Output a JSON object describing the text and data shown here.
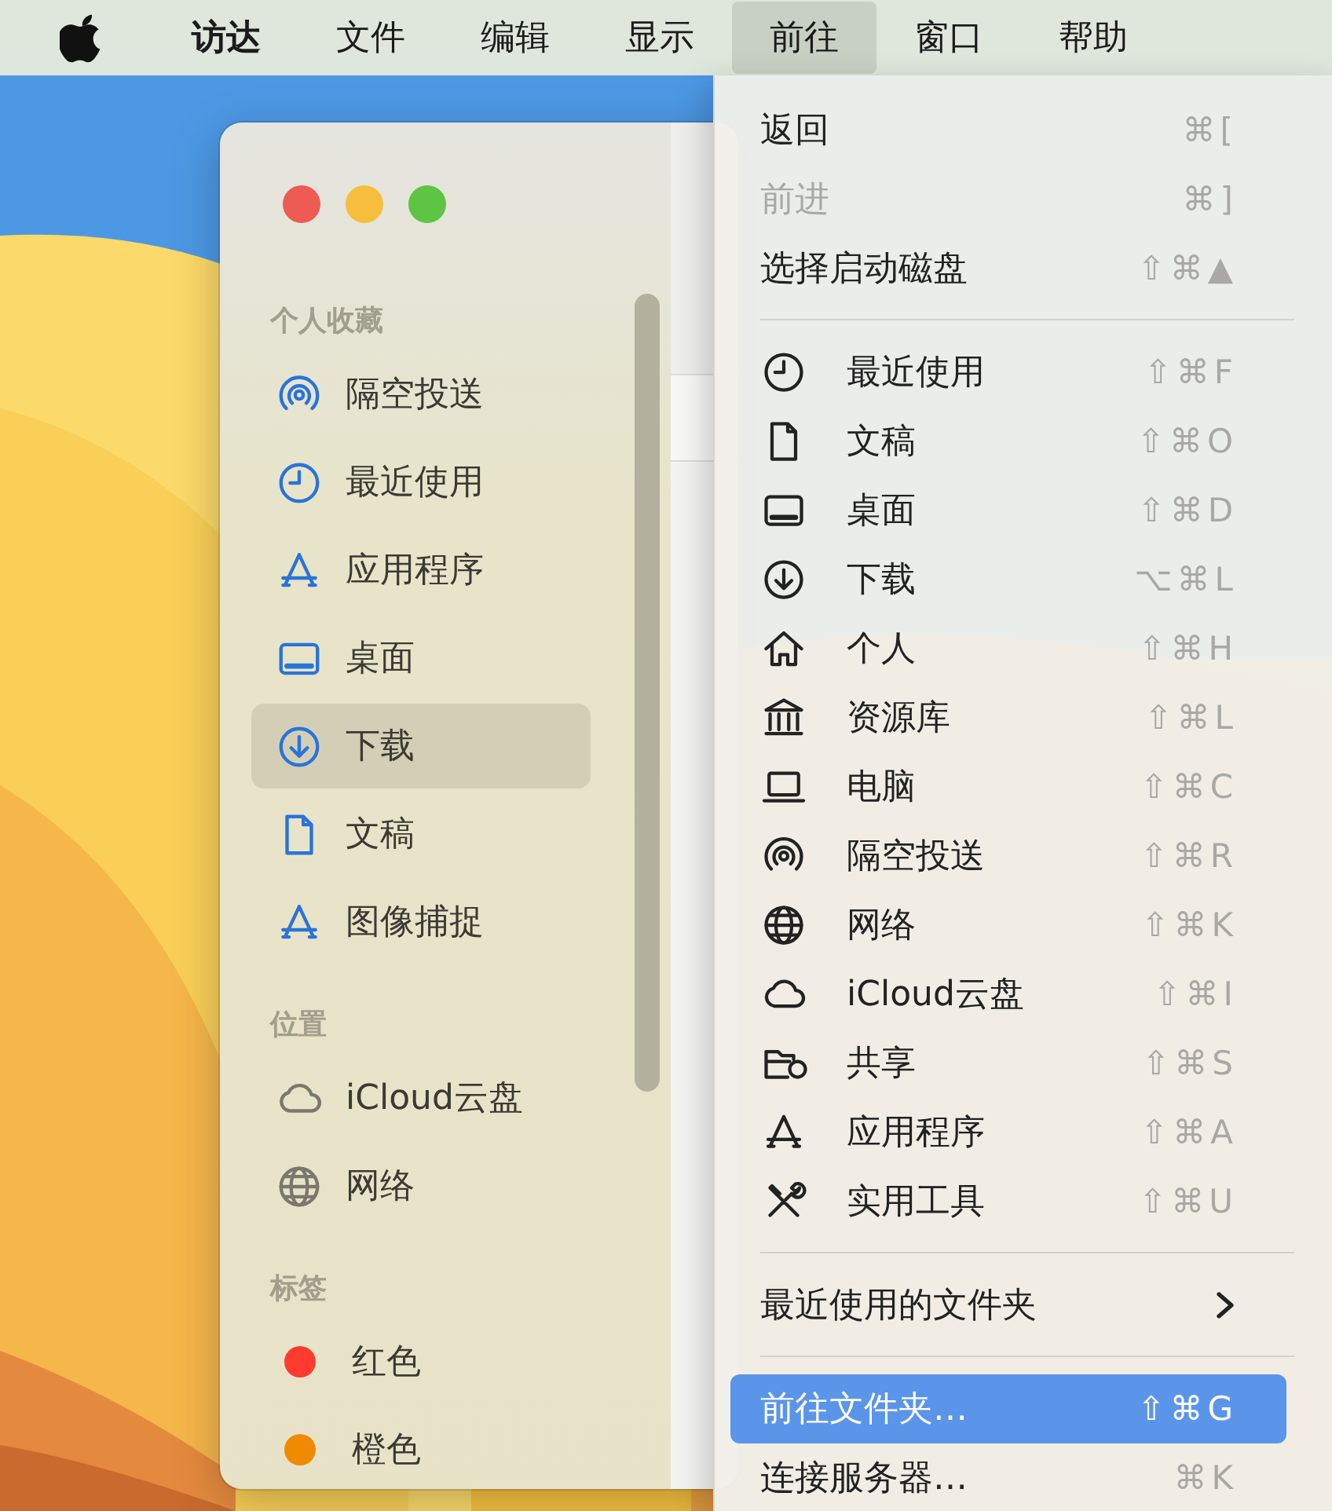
{
  "menu_bar": {
    "items": [
      {
        "label": "访达",
        "kind": "app",
        "selected": false
      },
      {
        "label": "文件",
        "kind": "menu",
        "selected": false
      },
      {
        "label": "编辑",
        "kind": "menu",
        "selected": false
      },
      {
        "label": "显示",
        "kind": "menu",
        "selected": false
      },
      {
        "label": "前往",
        "kind": "menu",
        "selected": true
      },
      {
        "label": "窗口",
        "kind": "menu",
        "selected": false
      },
      {
        "label": "帮助",
        "kind": "menu",
        "selected": false
      }
    ]
  },
  "finder_window": {
    "sidebar": {
      "sections": [
        {
          "header": "个人收藏",
          "items": [
            {
              "label": "隔空投送",
              "selected": false
            },
            {
              "label": "最近使用",
              "selected": false
            },
            {
              "label": "应用程序",
              "selected": false
            },
            {
              "label": "桌面",
              "selected": false
            },
            {
              "label": "下载",
              "selected": true
            },
            {
              "label": "文稿",
              "selected": false
            },
            {
              "label": "图像捕捉",
              "selected": false
            }
          ]
        },
        {
          "header": "位置",
          "items": [
            {
              "label": "iCloud云盘",
              "selected": false
            },
            {
              "label": "网络",
              "selected": false
            }
          ]
        },
        {
          "header": "标签",
          "items": [
            {
              "label": "红色",
              "selected": false,
              "color": "#ff3b30"
            },
            {
              "label": "橙色",
              "selected": false,
              "color": "#f08a00"
            }
          ]
        }
      ]
    }
  },
  "go_menu": {
    "items": [
      {
        "kind": "plain",
        "label": "返回",
        "shortcut": "⌘[",
        "disabled": false,
        "selected": false
      },
      {
        "kind": "plain",
        "label": "前进",
        "shortcut": "⌘]",
        "disabled": true,
        "selected": false
      },
      {
        "kind": "plain",
        "label": "选择启动磁盘",
        "shortcut": "⇧⌘▲",
        "disabled": false,
        "selected": false
      },
      {
        "kind": "separator"
      },
      {
        "kind": "icon",
        "label": "最近使用",
        "shortcut": "⇧⌘F",
        "disabled": false,
        "selected": false
      },
      {
        "kind": "icon",
        "label": "文稿",
        "shortcut": "⇧⌘O",
        "disabled": false,
        "selected": false
      },
      {
        "kind": "icon",
        "label": "桌面",
        "shortcut": "⇧⌘D",
        "disabled": false,
        "selected": false
      },
      {
        "kind": "icon",
        "label": "下载",
        "shortcut": "⌥⌘L",
        "disabled": false,
        "selected": false
      },
      {
        "kind": "icon",
        "label": "个人",
        "shortcut": "⇧⌘H",
        "disabled": false,
        "selected": false
      },
      {
        "kind": "icon",
        "label": "资源库",
        "shortcut": "⇧⌘L",
        "disabled": false,
        "selected": false
      },
      {
        "kind": "icon",
        "label": "电脑",
        "shortcut": "⇧⌘C",
        "disabled": false,
        "selected": false
      },
      {
        "kind": "icon",
        "label": "隔空投送",
        "shortcut": "⇧⌘R",
        "disabled": false,
        "selected": false
      },
      {
        "kind": "icon",
        "label": "网络",
        "shortcut": "⇧⌘K",
        "disabled": false,
        "selected": false
      },
      {
        "kind": "icon",
        "label": "iCloud云盘",
        "shortcut": "⇧⌘I",
        "disabled": false,
        "selected": false
      },
      {
        "kind": "icon",
        "label": "共享",
        "shortcut": "⇧⌘S",
        "disabled": false,
        "selected": false
      },
      {
        "kind": "icon",
        "label": "应用程序",
        "shortcut": "⇧⌘A",
        "disabled": false,
        "selected": false
      },
      {
        "kind": "icon",
        "label": "实用工具",
        "shortcut": "⇧⌘U",
        "disabled": false,
        "selected": false
      },
      {
        "kind": "separator"
      },
      {
        "kind": "submenu",
        "label": "最近使用的文件夹",
        "disabled": false,
        "selected": false
      },
      {
        "kind": "separator"
      },
      {
        "kind": "plain",
        "label": "前往文件夹…",
        "shortcut": "⇧⌘G",
        "disabled": false,
        "selected": true
      },
      {
        "kind": "plain",
        "label": "连接服务器…",
        "shortcut": "⌘K",
        "disabled": false,
        "selected": false
      }
    ]
  }
}
